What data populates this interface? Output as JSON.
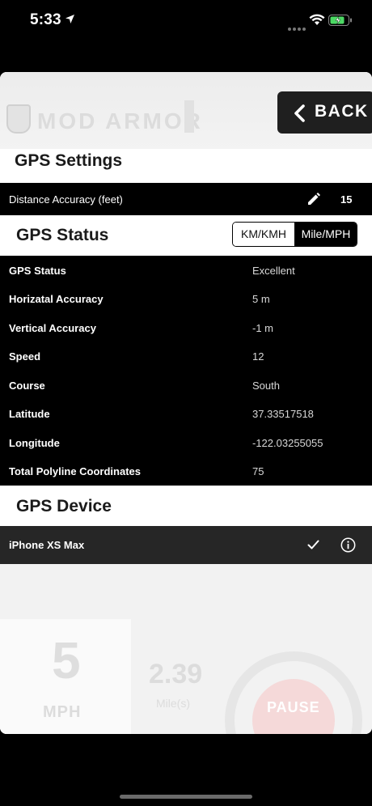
{
  "status_bar": {
    "time": "5:33"
  },
  "header": {
    "logo_text": "MOD ARMOR",
    "back_label": "BACK"
  },
  "gps_settings": {
    "title": "GPS Settings",
    "distance_accuracy_label": "Distance Accuracy (feet)",
    "distance_accuracy_value": "15"
  },
  "gps_status": {
    "title": "GPS Status",
    "units": {
      "option_a": "KM/KMH",
      "option_b": "Mile/MPH",
      "selected": "Mile/MPH"
    },
    "rows": [
      {
        "label": "GPS Status",
        "value": "Excellent"
      },
      {
        "label": "Horizatal Accuracy",
        "value": "5 m"
      },
      {
        "label": "Vertical Accuracy",
        "value": "-1 m"
      },
      {
        "label": "Speed",
        "value": "12"
      },
      {
        "label": "Course",
        "value": "South"
      },
      {
        "label": "Latitude",
        "value": "37.33517518"
      },
      {
        "label": "Longitude",
        "value": "-122.03255055"
      },
      {
        "label": "Total Polyline Coordinates",
        "value": "75"
      }
    ]
  },
  "gps_device": {
    "title": "GPS Device",
    "device_name": "iPhone XS Max"
  },
  "background": {
    "speed_value": "5",
    "speed_unit": "MPH",
    "distance_value": "2.39",
    "distance_unit": "Mile(s)",
    "pause_label": "PAUSE"
  }
}
